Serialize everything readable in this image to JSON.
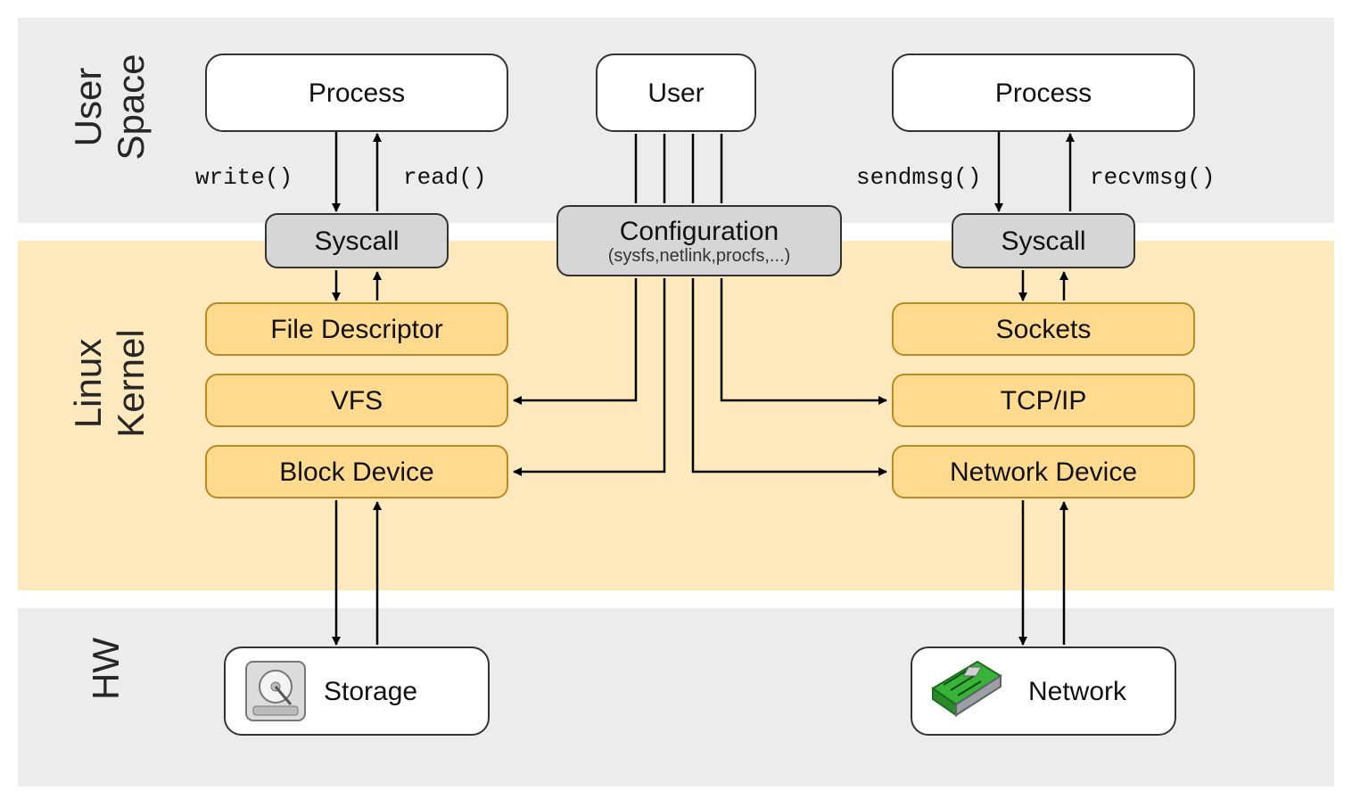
{
  "layers": {
    "user": "User\nSpace",
    "kernel": "Linux\nKernel",
    "hw": "HW"
  },
  "left": {
    "process": "Process",
    "syscall": "Syscall",
    "fd": "File Descriptor",
    "vfs": "VFS",
    "block": "Block Device",
    "storage": "Storage",
    "write": "write()",
    "read": "read()"
  },
  "center": {
    "user": "User",
    "config_title": "Configuration",
    "config_sub": "(sysfs,netlink,procfs,...)"
  },
  "right": {
    "process": "Process",
    "syscall": "Syscall",
    "sockets": "Sockets",
    "tcpip": "TCP/IP",
    "netdev": "Network Device",
    "network": "Network",
    "sendmsg": "sendmsg()",
    "recvmsg": "recvmsg()"
  }
}
